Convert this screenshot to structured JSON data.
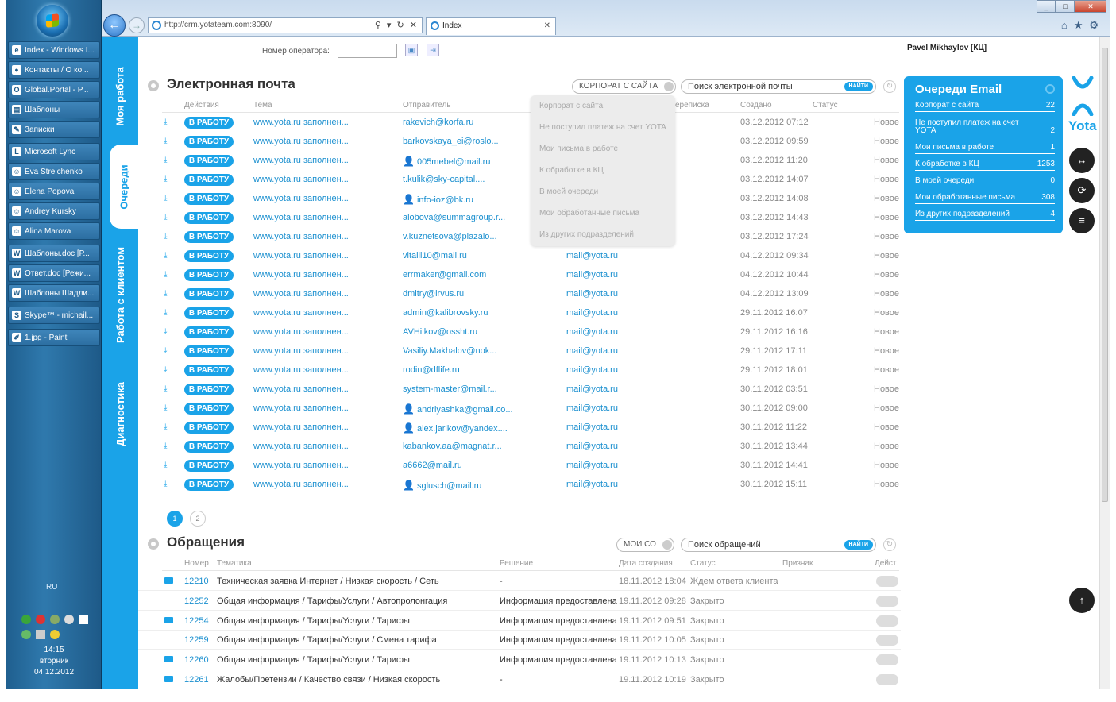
{
  "taskbar": {
    "items": [
      {
        "icon": "ie-icon",
        "label": "Index - Windows I..."
      },
      {
        "icon": "chrome-icon",
        "label": "Контакты / О ко..."
      },
      {
        "icon": "outlook-icon",
        "label": "Global.Portal - P..."
      },
      {
        "icon": "folder-icon",
        "label": "Шаблоны"
      },
      {
        "icon": "notes-icon",
        "label": "Записки"
      },
      {
        "icon": "lync-icon",
        "label": "Microsoft Lync"
      },
      {
        "icon": "contact-icon",
        "label": "Eva Strelchenko"
      },
      {
        "icon": "contact-icon",
        "label": "Elena Popova"
      },
      {
        "icon": "contact-icon",
        "label": "Andrey Kursky"
      },
      {
        "icon": "contact-icon",
        "label": "Alina Marova"
      },
      {
        "icon": "word-icon",
        "label": "Шаблоны.doc [Р..."
      },
      {
        "icon": "word-icon",
        "label": "Ответ.doc [Режи..."
      },
      {
        "icon": "word-icon",
        "label": "Шаблоны Шадли..."
      },
      {
        "icon": "skype-icon",
        "label": "Skype™ - michail..."
      },
      {
        "icon": "paint-icon",
        "label": "1.jpg - Paint"
      }
    ],
    "lang": "RU",
    "clock": {
      "time": "14:15",
      "day": "вторник",
      "date": "04.12.2012"
    }
  },
  "browser": {
    "address": "http://crm.yotateam.com:8090/",
    "tab_title": "Index"
  },
  "nav": {
    "my_work": "Моя работа",
    "queues": "Очереди",
    "client_work": "Работа с клиентом",
    "diagnostics": "Диагностика"
  },
  "header": {
    "operator_label": "Номер оператора:",
    "user": "Pavel Mikhaylov [КЦ]"
  },
  "email": {
    "title": "Электронная почта",
    "filter": "КОРПОРАТ С САЙТА",
    "search_placeholder": "Поиск электронной почты",
    "find": "НАЙТИ",
    "columns": {
      "actions": "Действия",
      "subject": "Тема",
      "sender": "Отправитель",
      "correspondence": "ереписка",
      "created": "Создано",
      "status": "Статус"
    },
    "work_btn": "В РАБОТУ",
    "rows": [
      {
        "subject": "www.yota.ru заполнен...",
        "from": "rakevich@korfa.ru",
        "to": "",
        "date": "03.12.2012 07:12",
        "status": "Новое",
        "person": false
      },
      {
        "subject": "www.yota.ru заполнен...",
        "from": "barkovskaya_ei@roslo...",
        "to": "",
        "date": "03.12.2012 09:59",
        "status": "Новое",
        "person": false
      },
      {
        "subject": "www.yota.ru заполнен...",
        "from": "005mebel@mail.ru",
        "to": "",
        "date": "03.12.2012 11:20",
        "status": "Новое",
        "person": true
      },
      {
        "subject": "www.yota.ru заполнен...",
        "from": "t.kulik@sky-capital....",
        "to": "",
        "date": "03.12.2012 14:07",
        "status": "Новое",
        "person": false
      },
      {
        "subject": "www.yota.ru заполнен...",
        "from": "info-ioz@bk.ru",
        "to": "",
        "date": "03.12.2012 14:08",
        "status": "Новое",
        "person": true
      },
      {
        "subject": "www.yota.ru заполнен...",
        "from": "alobova@summagroup.r...",
        "to": "",
        "date": "03.12.2012 14:43",
        "status": "Новое",
        "person": false
      },
      {
        "subject": "www.yota.ru заполнен...",
        "from": "v.kuznetsova@plazalo...",
        "to": "",
        "date": "03.12.2012 17:24",
        "status": "Новое",
        "person": false
      },
      {
        "subject": "www.yota.ru заполнен...",
        "from": "vitalli10@mail.ru",
        "to": "mail@yota.ru",
        "date": "04.12.2012 09:34",
        "status": "Новое",
        "person": false
      },
      {
        "subject": "www.yota.ru заполнен...",
        "from": "errmaker@gmail.com",
        "to": "mail@yota.ru",
        "date": "04.12.2012 10:44",
        "status": "Новое",
        "person": false
      },
      {
        "subject": "www.yota.ru заполнен...",
        "from": "dmitry@irvus.ru",
        "to": "mail@yota.ru",
        "date": "04.12.2012 13:09",
        "status": "Новое",
        "person": false
      },
      {
        "subject": "www.yota.ru заполнен...",
        "from": "admin@kalibrovsky.ru",
        "to": "mail@yota.ru",
        "date": "29.11.2012 16:07",
        "status": "Новое",
        "person": false
      },
      {
        "subject": "www.yota.ru заполнен...",
        "from": "AVHilkov@ossht.ru",
        "to": "mail@yota.ru",
        "date": "29.11.2012 16:16",
        "status": "Новое",
        "person": false
      },
      {
        "subject": "www.yota.ru заполнен...",
        "from": "Vasiliy.Makhalov@nok...",
        "to": "mail@yota.ru",
        "date": "29.11.2012 17:11",
        "status": "Новое",
        "person": false
      },
      {
        "subject": "www.yota.ru заполнен...",
        "from": "rodin@dflife.ru",
        "to": "mail@yota.ru",
        "date": "29.11.2012 18:01",
        "status": "Новое",
        "person": false
      },
      {
        "subject": "www.yota.ru заполнен...",
        "from": "system-master@mail.r...",
        "to": "mail@yota.ru",
        "date": "30.11.2012 03:51",
        "status": "Новое",
        "person": false
      },
      {
        "subject": "www.yota.ru заполнен...",
        "from": "andriyashka@gmail.co...",
        "to": "mail@yota.ru",
        "date": "30.11.2012 09:00",
        "status": "Новое",
        "person": true
      },
      {
        "subject": "www.yota.ru заполнен...",
        "from": "alex.jarikov@yandex....",
        "to": "mail@yota.ru",
        "date": "30.11.2012 11:22",
        "status": "Новое",
        "person": true
      },
      {
        "subject": "www.yota.ru заполнен...",
        "from": "kabankov.aa@magnat.r...",
        "to": "mail@yota.ru",
        "date": "30.11.2012 13:44",
        "status": "Новое",
        "person": false
      },
      {
        "subject": "www.yota.ru заполнен...",
        "from": "a6662@mail.ru",
        "to": "mail@yota.ru",
        "date": "30.11.2012 14:41",
        "status": "Новое",
        "person": false
      },
      {
        "subject": "www.yota.ru заполнен...",
        "from": "sglusch@mail.ru",
        "to": "mail@yota.ru",
        "date": "30.11.2012 15:11",
        "status": "Новое",
        "person": true
      }
    ],
    "pages": [
      "1",
      "2"
    ]
  },
  "dropdown": {
    "items": [
      "Корпорат с сайта",
      "Не поступил платеж на счет YOTA",
      "Мои письма в работе",
      "К обработке в КЦ",
      "В моей очереди",
      "Мои обработанные письма",
      "Из других подразделений"
    ]
  },
  "requests": {
    "title": "Обращения",
    "filter": "МОИ СО",
    "search_placeholder": "Поиск обращений",
    "find": "НАЙТИ",
    "columns": {
      "num": "Номер",
      "topic": "Тематика",
      "solution": "Решение",
      "created": "Дата создания",
      "status": "Статус",
      "sign": "Признак",
      "action": "Дейст"
    },
    "rows": [
      {
        "num": "12210",
        "topic": "Техническая заявка Интернет / Низкая скорость / Сеть",
        "solution": "-",
        "date": "18.11.2012 18:04",
        "status": "Ждем ответа клиента",
        "mail": true
      },
      {
        "num": "12252",
        "topic": "Общая информация / Тарифы/Услуги / Автопролонгация",
        "solution": "Информация предоставлена",
        "date": "19.11.2012 09:28",
        "status": "Закрыто",
        "mail": false
      },
      {
        "num": "12254",
        "topic": "Общая информация / Тарифы/Услуги / Тарифы",
        "solution": "Информация предоставлена",
        "date": "19.11.2012 09:51",
        "status": "Закрыто",
        "mail": true
      },
      {
        "num": "12259",
        "topic": "Общая информация / Тарифы/Услуги / Смена тарифа",
        "solution": "Информация предоставлена",
        "date": "19.11.2012 10:05",
        "status": "Закрыто",
        "mail": false
      },
      {
        "num": "12260",
        "topic": "Общая информация / Тарифы/Услуги / Тарифы",
        "solution": "Информация предоставлена",
        "date": "19.11.2012 10:13",
        "status": "Закрыто",
        "mail": true
      },
      {
        "num": "12261",
        "topic": "Жалобы/Претензии / Качество связи / Низкая скорость",
        "solution": "-",
        "date": "19.11.2012 10:19",
        "status": "Закрыто",
        "mail": true
      }
    ]
  },
  "queue": {
    "title": "Очереди Email",
    "items": [
      {
        "label": "Корпорат с сайта",
        "count": "22"
      },
      {
        "label": "Не поступил платеж на счет YOTA",
        "count": "2"
      },
      {
        "label": "Мои письма в работе",
        "count": "1"
      },
      {
        "label": "К обработке в КЦ",
        "count": "1253"
      },
      {
        "label": "В моей очереди",
        "count": "0"
      },
      {
        "label": "Мои обработанные письма",
        "count": "308"
      },
      {
        "label": "Из других подразделений",
        "count": "4"
      }
    ]
  },
  "brand": {
    "logo_text": "Yota",
    "accent": "#1aa3e8"
  }
}
